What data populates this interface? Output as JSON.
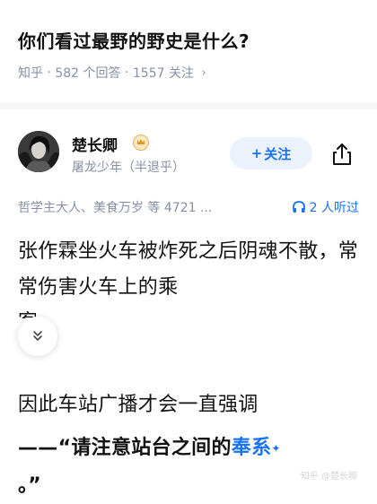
{
  "question": {
    "title": "你们看过最野的野史是什么?",
    "meta": {
      "site": "知乎",
      "sep1": "·",
      "answers": "582 个回答",
      "sep2": "·",
      "followers": "1557 关注",
      "chevron": "›"
    }
  },
  "answer": {
    "author": {
      "name": "楚长卿",
      "badge_icon": "crown-badge-icon",
      "bio": "屠龙少年（半退乎）"
    },
    "follow_button": {
      "plus": "+",
      "label": "关注"
    },
    "share_icon": "share-icon",
    "liked_by": "哲学主大人、美食万岁 等 4721 ...",
    "listen": {
      "icon": "headphones-icon",
      "label": "2 人听过"
    },
    "paragraph1": "张作霖坐火车被炸死之后阴魂不散，常常伤害火车上的乘",
    "paragraph1_cut": "客",
    "paragraph2": "因此车站广播才会一直强调",
    "paragraph3_prefix": "——“请注意站台之间的",
    "paragraph3_highlight": "奉系",
    "paragraph3_star": "✦",
    "paragraph4": "。”",
    "expand_icon": "double-chevron-down-icon",
    "watermark": "知乎 @楚长卿"
  },
  "colors": {
    "brand_blue": "#1772f6",
    "meta_gray": "#8590a6",
    "follow_bg": "#ebf2fc"
  }
}
